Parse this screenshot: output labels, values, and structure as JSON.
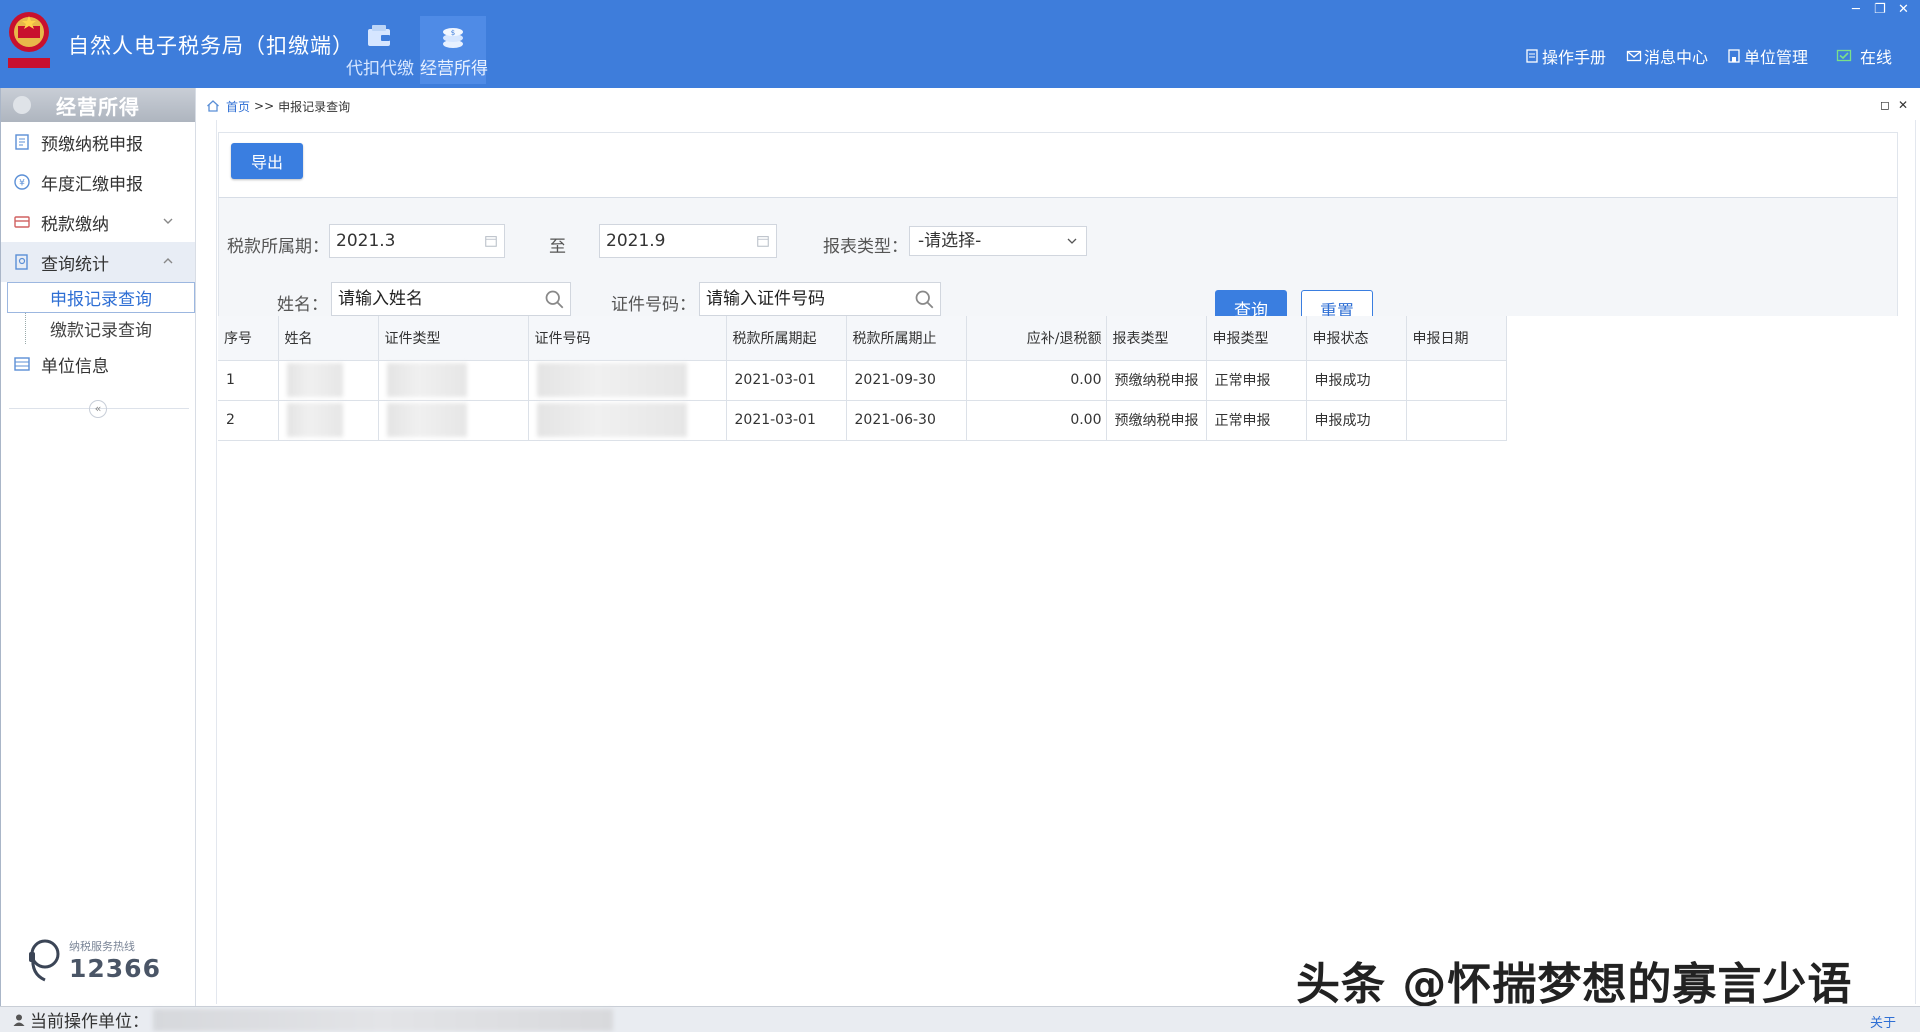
{
  "header": {
    "app_title": "自然人电子税务局（扣缴端）",
    "nav_tabs": [
      {
        "label": "代扣代缴",
        "icon": "wallet-icon"
      },
      {
        "label": "经营所得",
        "icon": "coins-icon"
      }
    ],
    "links": {
      "manual": "操作手册",
      "messages": "消息中心",
      "unit_mgmt": "单位管理",
      "online": "在线"
    },
    "window_controls": {
      "minimize": "─",
      "restore": "❐",
      "close": "✕"
    }
  },
  "sidebar": {
    "title": "经营所得",
    "items": [
      {
        "label": "预缴纳税申报",
        "icon": "form-icon"
      },
      {
        "label": "年度汇缴申报",
        "icon": "yen-coin-icon"
      },
      {
        "label": "税款缴纳",
        "icon": "payment-icon",
        "arrow": "chevron-down-icon"
      },
      {
        "label": "查询统计",
        "icon": "query-icon",
        "arrow": "chevron-up-icon"
      },
      {
        "label": "单位信息",
        "icon": "list-icon"
      }
    ],
    "subitems": [
      {
        "label": "申报记录查询"
      },
      {
        "label": "缴款记录查询"
      }
    ],
    "collapse": "«",
    "hotline_label": "纳税服务热线",
    "hotline_number": "12366"
  },
  "breadcrumb": {
    "home": "首页",
    "sep": ">>",
    "current": "申报记录查询"
  },
  "panel_controls": {
    "maximize": "◻",
    "close": "✕"
  },
  "toolbar": {
    "export": "导出"
  },
  "form": {
    "period_label": "税款所属期：",
    "period_start": "2021.3",
    "to_label": "至",
    "period_end": "2021.9",
    "report_type_label": "报表类型：",
    "report_type_value": "-请选择-",
    "name_label": "姓名：",
    "name_placeholder": "请输入姓名",
    "id_label": "证件号码：",
    "id_placeholder": "请输入证件号码",
    "query_button": "查询",
    "reset_button": "重置"
  },
  "table": {
    "headers": [
      "序号",
      "姓名",
      "证件类型",
      "证件号码",
      "税款所属期起",
      "税款所属期止",
      "应补/退税额",
      "报表类型",
      "申报类型",
      "申报状态",
      "申报日期"
    ],
    "rows": [
      {
        "seq": "1",
        "start": "2021-03-01",
        "end": "2021-09-30",
        "amount": "0.00",
        "report_type": "预缴纳税申报",
        "decl_type": "正常申报",
        "status": "申报成功",
        "date": ""
      },
      {
        "seq": "2",
        "start": "2021-03-01",
        "end": "2021-06-30",
        "amount": "0.00",
        "report_type": "预缴纳税申报",
        "decl_type": "正常申报",
        "status": "申报成功",
        "date": ""
      }
    ]
  },
  "statusbar": {
    "current_unit_label": "当前操作单位：",
    "about": "关于"
  },
  "watermark": "头条 @怀揣梦想的寡言少语",
  "colors": {
    "header_bg": "#3e7ddb",
    "primary": "#3a7ee0",
    "link": "#2f6fd4"
  }
}
